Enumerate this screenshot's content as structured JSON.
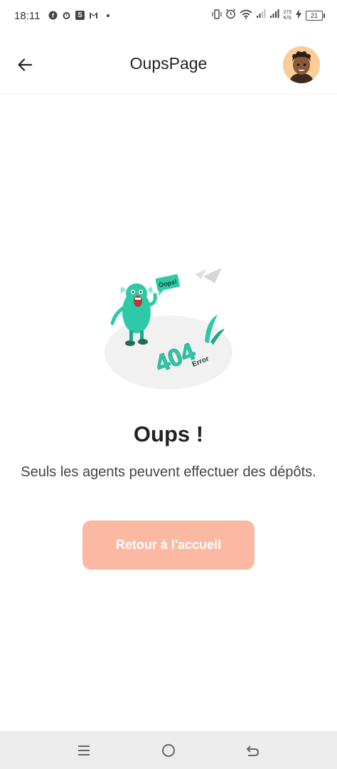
{
  "status_bar": {
    "time": "18:11",
    "notification_icons": [
      "facebook-icon",
      "alarm-icon",
      "s-app-icon",
      "gmail-icon",
      "more-dot-icon"
    ],
    "s_label": "S",
    "speed_value": "273",
    "speed_unit": "K/S",
    "battery": "21",
    "system_icons": [
      "vibrate-icon",
      "alarm-icon",
      "wifi-icon",
      "signal-icon",
      "signal-icon",
      "charging-icon",
      "battery-icon"
    ]
  },
  "app_bar": {
    "title": "OupsPage",
    "back_icon": "arrow-left-icon",
    "avatar_icon": "user-avatar-icon"
  },
  "illustration": {
    "bubble_text": "Oops!",
    "code_text": "404",
    "error_text": "Error",
    "accent_color": "#2ec9a7"
  },
  "content": {
    "heading": "Oups !",
    "message": "Seuls les agents peuvent effectuer des dépôts.",
    "button_label": "Retour à l'accueil",
    "button_color": "#fbb8a3"
  },
  "nav_bar": {
    "icons": [
      "menu-icon",
      "home-circle-icon",
      "back-icon"
    ]
  }
}
